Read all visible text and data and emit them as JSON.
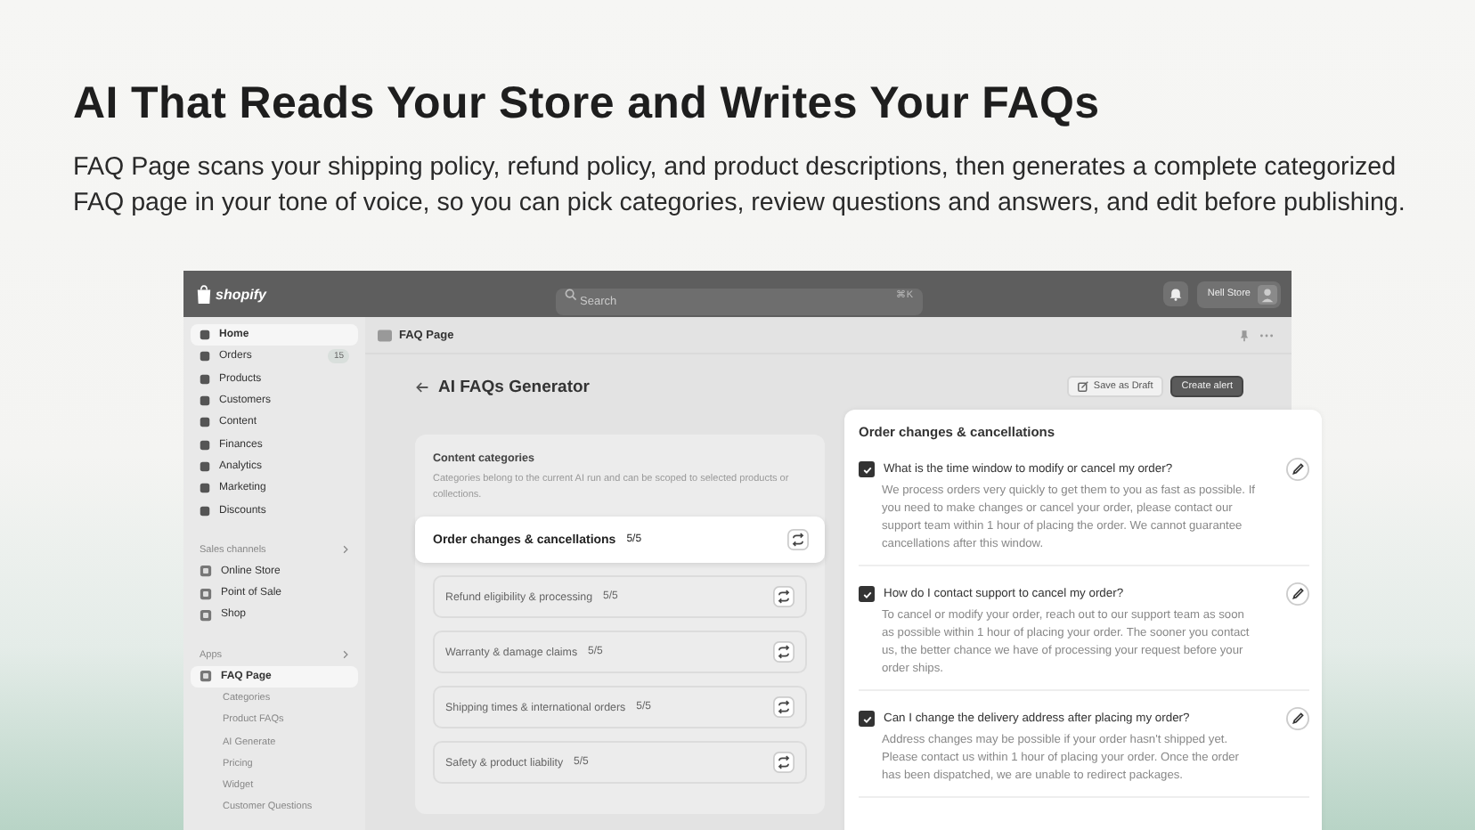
{
  "headline": "AI That Reads Your Store and Writes Your FAQs",
  "description": "FAQ Page scans your shipping policy, refund policy, and product descriptions, then generates a complete categorized FAQ page in your tone of voice, so you can pick categories, review questions and answers, and edit before publishing.",
  "topbar": {
    "logo": "shopify",
    "search": {
      "placeholder": "Search",
      "shortcut": "⌘K"
    },
    "store": "Nell Store"
  },
  "sidebar": {
    "items": [
      {
        "label": "Home",
        "selected": true
      },
      {
        "label": "Orders",
        "selected": false,
        "badge": "15"
      },
      {
        "label": "Products",
        "selected": false
      },
      {
        "label": "Customers",
        "selected": false
      },
      {
        "label": "Content",
        "selected": false
      },
      {
        "label": "Finances",
        "selected": false
      },
      {
        "label": "Analytics",
        "selected": false
      },
      {
        "label": "Marketing",
        "selected": false
      },
      {
        "label": "Discounts",
        "selected": false
      }
    ],
    "sections": [
      {
        "title": "Sales channels",
        "items": [
          {
            "label": "Online Store",
            "selected": false
          },
          {
            "label": "Point of Sale",
            "selected": false
          },
          {
            "label": "Shop",
            "selected": false
          }
        ]
      },
      {
        "title": "Apps",
        "items": [
          {
            "label": "FAQ Page",
            "selected": true,
            "children": [
              {
                "label": "Categories"
              },
              {
                "label": "Product FAQs"
              },
              {
                "label": "AI Generate"
              },
              {
                "label": "Pricing"
              },
              {
                "label": "Widget"
              },
              {
                "label": "Customer Questions"
              }
            ]
          }
        ]
      }
    ]
  },
  "app_header": "FAQ Page",
  "page_title": "AI FAQs Generator",
  "buttons": [
    {
      "label": "Save as Draft",
      "kind": "secondary"
    },
    {
      "label": "Create alert",
      "kind": "primary"
    }
  ],
  "categories_card": {
    "title": "Content categories",
    "description": "Categories belong to the current AI run and can be scoped to selected products or collections.",
    "categories": [
      {
        "name": "Order changes & cancellations",
        "count": "5/5",
        "selected": true
      },
      {
        "name": "Refund eligibility & processing",
        "count": "5/5",
        "selected": false
      },
      {
        "name": "Warranty & damage claims",
        "count": "5/5",
        "selected": false
      },
      {
        "name": "Shipping times & international orders",
        "count": "5/5",
        "selected": false
      },
      {
        "name": "Safety & product liability",
        "count": "5/5",
        "selected": false
      }
    ]
  },
  "faq_panel": {
    "title": "Order changes & cancellations",
    "items": [
      {
        "question": "What is the time window to modify or cancel my order?",
        "answer": "We process orders very quickly to get them to you as fast as possible. If you need to make changes or cancel your order, please contact our support team within 1 hour of placing the order. We cannot guarantee cancellations after this window.",
        "checked": true
      },
      {
        "question": "How do I contact support to cancel my order?",
        "answer": "To cancel or modify your order, reach out to our support team as soon as possible within 1 hour of placing your order. The sooner you contact us, the better chance we have of processing your request before your order ships.",
        "checked": true
      },
      {
        "question": "Can I change the delivery address after placing my order?",
        "answer": "Address changes may be possible if your order hasn't shipped yet. Please contact us within 1 hour of placing your order. Once the order has been dispatched, we are unable to redirect packages.",
        "checked": true
      }
    ]
  }
}
